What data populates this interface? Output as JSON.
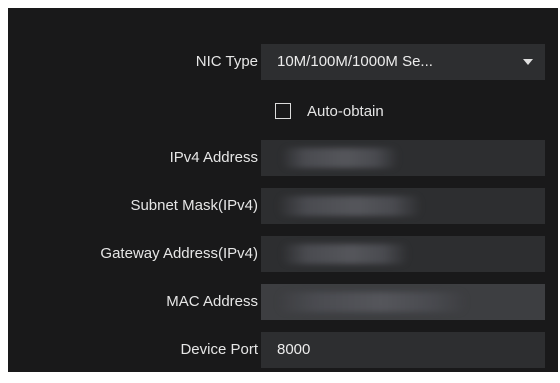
{
  "network": {
    "nic_type": {
      "label": "NIC Type",
      "value": "10M/100M/1000M Se..."
    },
    "auto_obtain": {
      "label": "Auto-obtain",
      "checked": false
    },
    "ipv4_address": {
      "label": "IPv4 Address"
    },
    "subnet_mask": {
      "label": "Subnet Mask(IPv4)"
    },
    "gateway": {
      "label": "Gateway Address(IPv4)"
    },
    "mac_address": {
      "label": "MAC Address"
    },
    "device_port": {
      "label": "Device Port",
      "value": "8000"
    }
  },
  "icons": {
    "dropdown": "chevron-down-icon"
  },
  "colors": {
    "panel_bg": "#19191a",
    "field_bg": "#2d2e30",
    "text": "#e6e6e6"
  }
}
